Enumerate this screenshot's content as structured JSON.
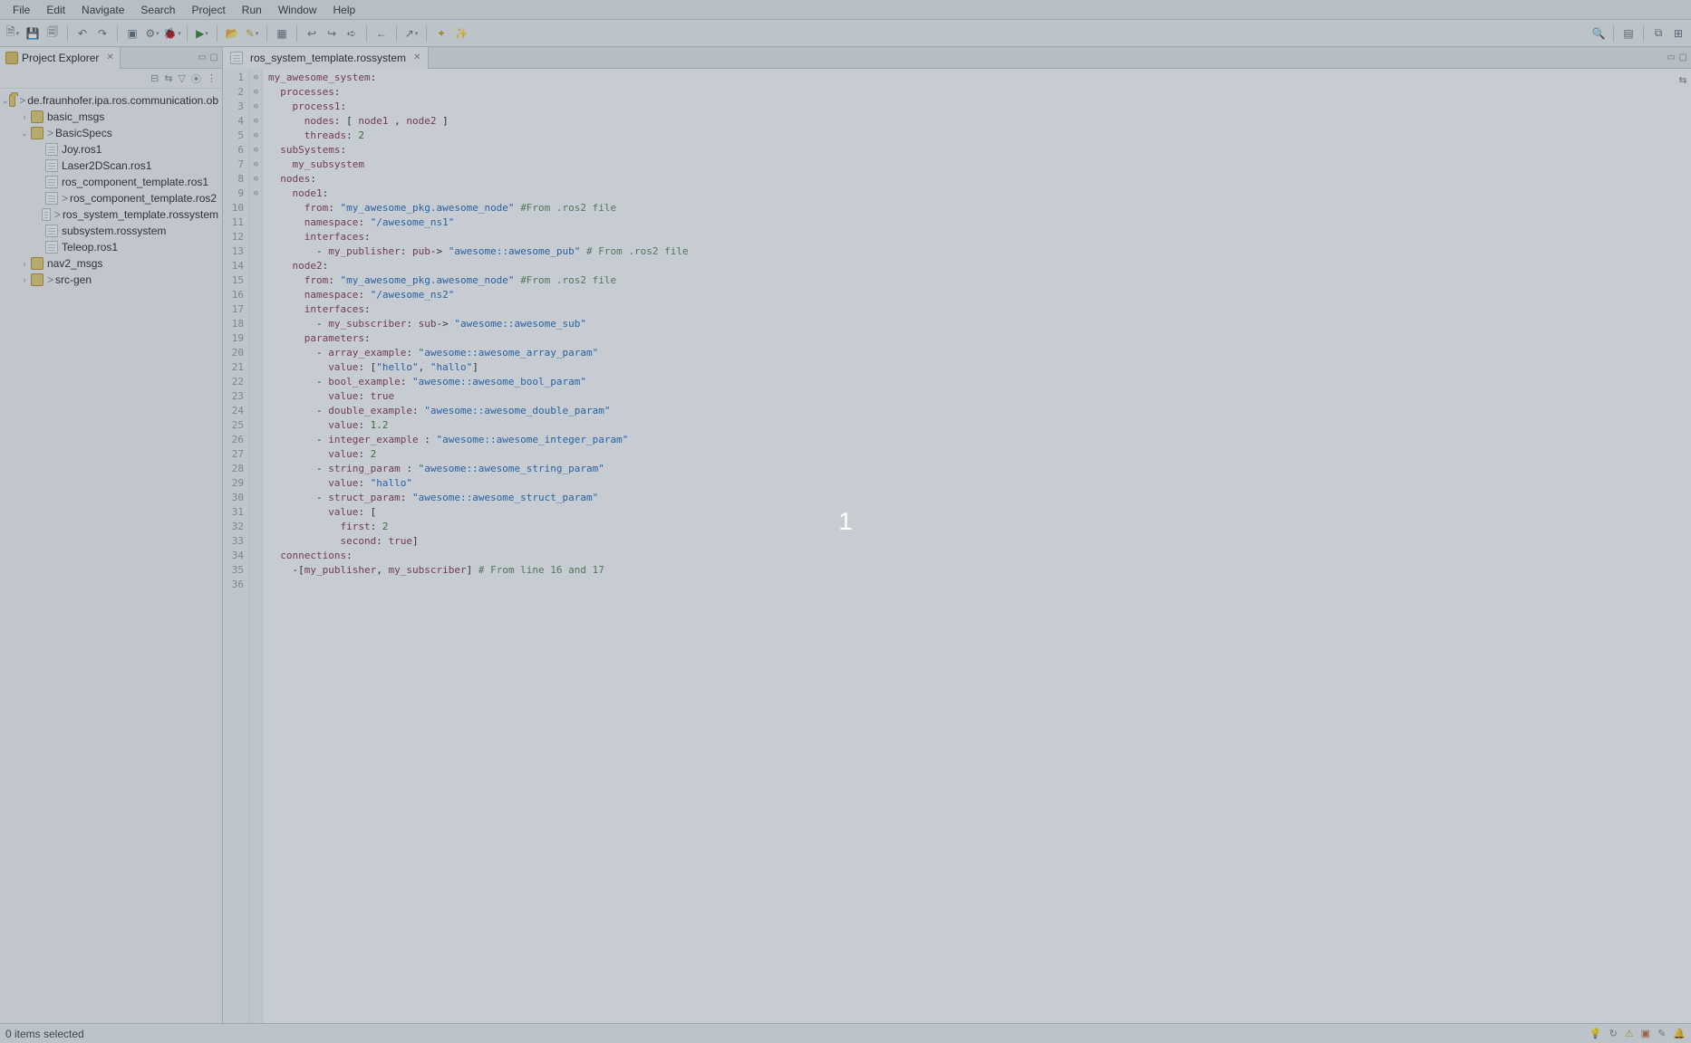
{
  "menu": {
    "items": [
      "File",
      "Edit",
      "Navigate",
      "Search",
      "Project",
      "Run",
      "Window",
      "Help"
    ]
  },
  "sidebar": {
    "view_title": "Project Explorer",
    "project": "de.fraunhofer.ipa.ros.communication.ob",
    "nodes": [
      {
        "label": "basic_msgs",
        "type": "folder",
        "depth": 1,
        "expand": "›",
        "decor": ""
      },
      {
        "label": "BasicSpecs",
        "type": "folder",
        "depth": 1,
        "expand": "⌄",
        "decor": "> "
      },
      {
        "label": "Joy.ros1",
        "type": "file",
        "depth": 2,
        "expand": "",
        "decor": ""
      },
      {
        "label": "Laser2DScan.ros1",
        "type": "file",
        "depth": 2,
        "expand": "",
        "decor": ""
      },
      {
        "label": "ros_component_template.ros1",
        "type": "file",
        "depth": 2,
        "expand": "",
        "decor": ""
      },
      {
        "label": "ros_component_template.ros2",
        "type": "file",
        "depth": 2,
        "expand": "",
        "decor": "> "
      },
      {
        "label": "ros_system_template.rossystem",
        "type": "file",
        "depth": 2,
        "expand": "",
        "decor": "> "
      },
      {
        "label": "subsystem.rossystem",
        "type": "file",
        "depth": 2,
        "expand": "",
        "decor": ""
      },
      {
        "label": "Teleop.ros1",
        "type": "file",
        "depth": 2,
        "expand": "",
        "decor": ""
      },
      {
        "label": "nav2_msgs",
        "type": "folder",
        "depth": 1,
        "expand": "›",
        "decor": ""
      },
      {
        "label": "src-gen",
        "type": "folder",
        "depth": 1,
        "expand": "›",
        "decor": "> "
      }
    ]
  },
  "editor": {
    "tab_title": "ros_system_template.rossystem",
    "foldables": [
      9,
      14,
      20,
      22,
      24,
      26,
      28,
      30,
      31
    ],
    "lines": [
      [
        [
          "my_awesome_system",
          "key"
        ],
        [
          ":",
          "sym"
        ]
      ],
      [
        [
          "  ",
          ""
        ],
        [
          "processes",
          "key"
        ],
        [
          ":",
          "sym"
        ]
      ],
      [
        [
          "    ",
          ""
        ],
        [
          "process1",
          "key"
        ],
        [
          ":",
          "sym"
        ]
      ],
      [
        [
          "      ",
          ""
        ],
        [
          "nodes",
          "key"
        ],
        [
          ": [ ",
          "sym"
        ],
        [
          "node1",
          "key"
        ],
        [
          " , ",
          "sym"
        ],
        [
          "node2",
          "key"
        ],
        [
          " ]",
          "sym"
        ]
      ],
      [
        [
          "      ",
          ""
        ],
        [
          "threads",
          "key"
        ],
        [
          ": ",
          "sym"
        ],
        [
          "2",
          "num"
        ]
      ],
      [
        [
          "  ",
          ""
        ],
        [
          "subSystems",
          "key"
        ],
        [
          ":",
          "sym"
        ]
      ],
      [
        [
          "    ",
          ""
        ],
        [
          "my_subsystem",
          "key"
        ]
      ],
      [
        [
          "  ",
          ""
        ],
        [
          "nodes",
          "key"
        ],
        [
          ":",
          "sym"
        ]
      ],
      [
        [
          "    ",
          ""
        ],
        [
          "node1",
          "key"
        ],
        [
          ":",
          "sym"
        ]
      ],
      [
        [
          "      ",
          ""
        ],
        [
          "from",
          "key"
        ],
        [
          ": ",
          "sym"
        ],
        [
          "\"my_awesome_pkg.awesome_node\"",
          "str"
        ],
        [
          " ",
          ""
        ],
        [
          "#From .ros2 file",
          "com"
        ]
      ],
      [
        [
          "      ",
          ""
        ],
        [
          "namespace",
          "key"
        ],
        [
          ": ",
          "sym"
        ],
        [
          "\"/awesome_ns1\"",
          "str"
        ]
      ],
      [
        [
          "      ",
          ""
        ],
        [
          "interfaces",
          "key"
        ],
        [
          ":",
          "sym"
        ]
      ],
      [
        [
          "        - ",
          ""
        ],
        [
          "my_publisher",
          "key"
        ],
        [
          ": ",
          "sym"
        ],
        [
          "pub",
          "key"
        ],
        [
          "-> ",
          "sym"
        ],
        [
          "\"awesome::awesome_pub\"",
          "str"
        ],
        [
          " ",
          ""
        ],
        [
          "# From .ros2 file",
          "com"
        ]
      ],
      [
        [
          "    ",
          ""
        ],
        [
          "node2",
          "key"
        ],
        [
          ":",
          "sym"
        ]
      ],
      [
        [
          "      ",
          ""
        ],
        [
          "from",
          "key"
        ],
        [
          ": ",
          "sym"
        ],
        [
          "\"my_awesome_pkg.awesome_node\"",
          "str"
        ],
        [
          " ",
          ""
        ],
        [
          "#From .ros2 file",
          "com"
        ]
      ],
      [
        [
          "      ",
          ""
        ],
        [
          "namespace",
          "key"
        ],
        [
          ": ",
          "sym"
        ],
        [
          "\"/awesome_ns2\"",
          "str"
        ]
      ],
      [
        [
          "      ",
          ""
        ],
        [
          "interfaces",
          "key"
        ],
        [
          ":",
          "sym"
        ]
      ],
      [
        [
          "        - ",
          ""
        ],
        [
          "my_subscriber",
          "key"
        ],
        [
          ": ",
          "sym"
        ],
        [
          "sub",
          "key"
        ],
        [
          "-> ",
          "sym"
        ],
        [
          "\"awesome::awesome_sub\"",
          "str"
        ]
      ],
      [
        [
          "      ",
          ""
        ],
        [
          "parameters",
          "key"
        ],
        [
          ":",
          "sym"
        ]
      ],
      [
        [
          "        - ",
          ""
        ],
        [
          "array_example",
          "key"
        ],
        [
          ": ",
          "sym"
        ],
        [
          "\"awesome::awesome_array_param\"",
          "str"
        ]
      ],
      [
        [
          "          ",
          ""
        ],
        [
          "value",
          "key"
        ],
        [
          ": [",
          "sym"
        ],
        [
          "\"hello\"",
          "str"
        ],
        [
          ", ",
          "sym"
        ],
        [
          "\"hallo\"",
          "str"
        ],
        [
          "]",
          "sym"
        ]
      ],
      [
        [
          "        - ",
          ""
        ],
        [
          "bool_example",
          "key"
        ],
        [
          ": ",
          "sym"
        ],
        [
          "\"awesome::awesome_bool_param\"",
          "str"
        ]
      ],
      [
        [
          "          ",
          ""
        ],
        [
          "value",
          "key"
        ],
        [
          ": ",
          "sym"
        ],
        [
          "true",
          "bool"
        ]
      ],
      [
        [
          "        - ",
          ""
        ],
        [
          "double_example",
          "key"
        ],
        [
          ": ",
          "sym"
        ],
        [
          "\"awesome::awesome_double_param\"",
          "str"
        ]
      ],
      [
        [
          "          ",
          ""
        ],
        [
          "value",
          "key"
        ],
        [
          ": ",
          "sym"
        ],
        [
          "1.2",
          "num"
        ]
      ],
      [
        [
          "        - ",
          ""
        ],
        [
          "integer_example ",
          "key"
        ],
        [
          ": ",
          "sym"
        ],
        [
          "\"awesome::awesome_integer_param\"",
          "str"
        ]
      ],
      [
        [
          "          ",
          ""
        ],
        [
          "value",
          "key"
        ],
        [
          ": ",
          "sym"
        ],
        [
          "2",
          "num"
        ]
      ],
      [
        [
          "        - ",
          ""
        ],
        [
          "string_param ",
          "key"
        ],
        [
          ": ",
          "sym"
        ],
        [
          "\"awesome::awesome_string_param\"",
          "str"
        ]
      ],
      [
        [
          "          ",
          ""
        ],
        [
          "value",
          "key"
        ],
        [
          ": ",
          "sym"
        ],
        [
          "\"hallo\"",
          "str"
        ]
      ],
      [
        [
          "        - ",
          ""
        ],
        [
          "struct_param",
          "key"
        ],
        [
          ": ",
          "sym"
        ],
        [
          "\"awesome::awesome_struct_param\"",
          "str"
        ]
      ],
      [
        [
          "          ",
          ""
        ],
        [
          "value",
          "key"
        ],
        [
          ": [",
          "sym"
        ]
      ],
      [
        [
          "            ",
          ""
        ],
        [
          "first",
          "key"
        ],
        [
          ": ",
          "sym"
        ],
        [
          "2",
          "num"
        ]
      ],
      [
        [
          "            ",
          ""
        ],
        [
          "second",
          "key"
        ],
        [
          ": ",
          "sym"
        ],
        [
          "true",
          "bool"
        ],
        [
          "]",
          "sym"
        ]
      ],
      [
        [
          "  ",
          ""
        ],
        [
          "connections",
          "key"
        ],
        [
          ":",
          "sym"
        ]
      ],
      [
        [
          "    -[",
          ""
        ],
        [
          "my_publisher",
          "key"
        ],
        [
          ", ",
          "sym"
        ],
        [
          "my_subscriber",
          "key"
        ],
        [
          "] ",
          "sym"
        ],
        [
          "# From line 16 and 17",
          "com"
        ]
      ],
      [
        [
          "",
          ""
        ]
      ]
    ]
  },
  "status": {
    "left": "0 items selected"
  },
  "overlay": {
    "number": "1"
  }
}
